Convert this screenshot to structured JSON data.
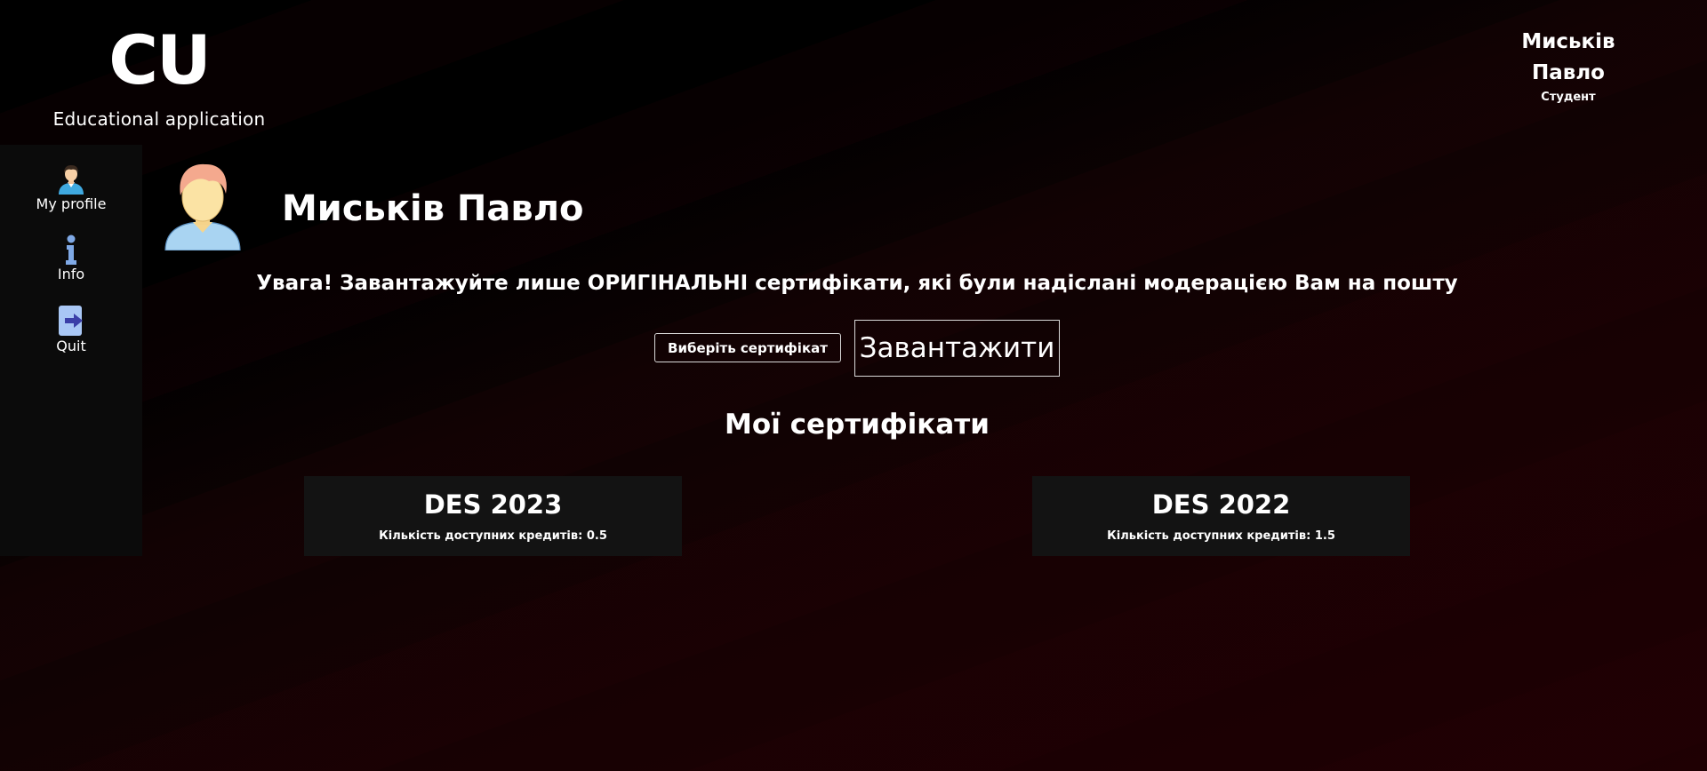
{
  "brand": {
    "logo": "CU",
    "subtitle": "Educational application"
  },
  "user": {
    "first_line": "Миськів",
    "second_line": "Павло",
    "role": "Студент"
  },
  "sidebar": {
    "items": [
      {
        "label": "My profile",
        "icon": "user-profile-icon"
      },
      {
        "label": "Info",
        "icon": "info-icon"
      },
      {
        "label": "Quit",
        "icon": "exit-icon"
      }
    ]
  },
  "profile": {
    "name": "Миськів Павло",
    "avatar_icon": "user-avatar-icon"
  },
  "upload": {
    "warning": "Увага! Завантажуйте лише ОРИГІНАЛЬНІ сертифікати, які були надіслані модерацією Вам на пошту",
    "choose_label": "Виберіть сертифікат",
    "upload_label": "Завантажити"
  },
  "certificates": {
    "title": "Мої сертифікати",
    "items": [
      {
        "name": "DES 2023",
        "credits": "Кількість доступних кредитів: 0.5"
      },
      {
        "name": "DES 2022",
        "credits": "Кількість доступних кредитів: 1.5"
      }
    ]
  },
  "colors": {
    "background_top": "#000000",
    "background_bottom": "#1f0003",
    "sidebar": "#0b0b0b",
    "card": "#131313",
    "text": "#ffffff"
  }
}
